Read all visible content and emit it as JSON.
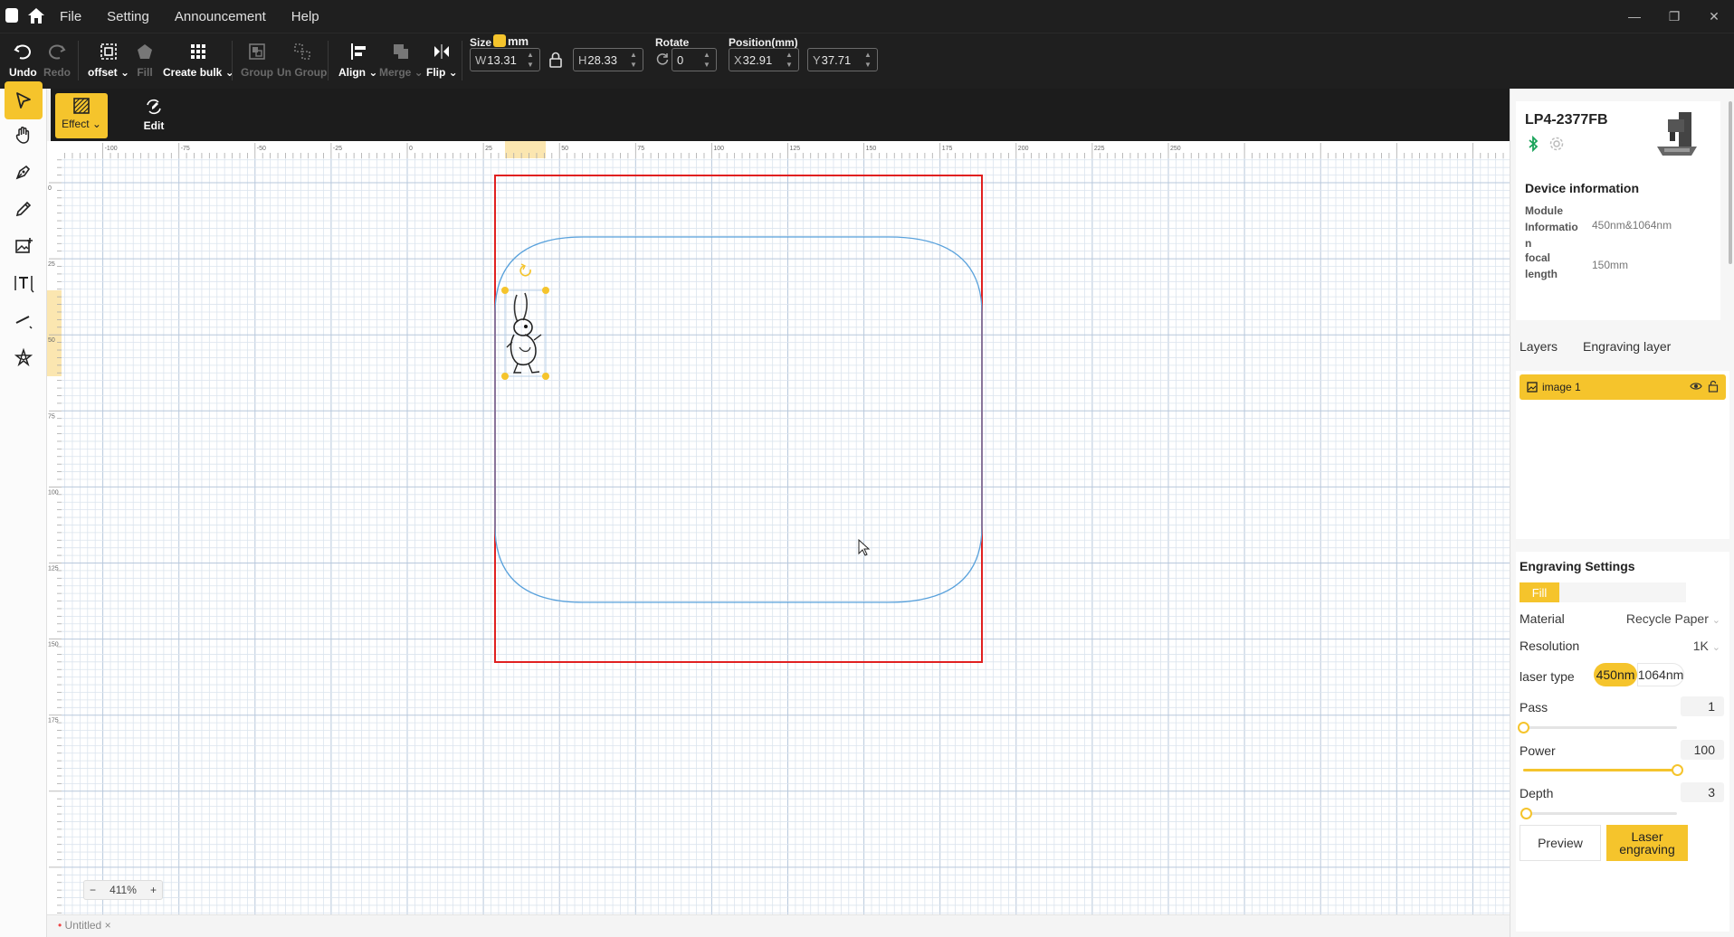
{
  "titlebar": {
    "menu": [
      "File",
      "Setting",
      "Announcement",
      "Help"
    ]
  },
  "toolbar": {
    "undo": "Undo",
    "redo": "Redo",
    "offset": "offset",
    "fill": "Fill",
    "create_bulk": "Create bulk",
    "group": "Group",
    "ungroup": "Un Group",
    "align": "Align",
    "merge": "Merge",
    "flip": "Flip",
    "size_label": "Size",
    "unit": "mm",
    "width_prefix": "W",
    "width": "13.31",
    "height_prefix": "H",
    "height": "28.33",
    "rotate_label": "Rotate",
    "rotate": "0",
    "position_label": "Position(mm)",
    "x_prefix": "X",
    "x": "32.91",
    "y_prefix": "Y",
    "y": "37.71"
  },
  "subbar": {
    "effect": "Effect",
    "edit": "Edit"
  },
  "ruler": {
    "h_labels": [
      "-100",
      "-75",
      "-50",
      "-25",
      "0",
      "25",
      "50",
      "75",
      "100",
      "125",
      "150",
      "175",
      "200",
      "225",
      "250"
    ],
    "v_labels": [
      "0",
      "25",
      "50",
      "75",
      "100",
      "125",
      "150",
      "175"
    ]
  },
  "zoom": {
    "minus": "−",
    "value": "411%",
    "plus": "+"
  },
  "document_tab": {
    "name": "Untitled",
    "close": "×"
  },
  "device": {
    "name": "LP4-2377FB",
    "info_title": "Device information",
    "module_label": "Module Informatio n",
    "module_value": "450nm&1064nm",
    "focal_label": "focal length",
    "focal_value": "150mm"
  },
  "layers": {
    "tab_layers": "Layers",
    "tab_engraving": "Engraving layer",
    "item": "image 1"
  },
  "engraving": {
    "title": "Engraving Settings",
    "mode": "Fill",
    "material_label": "Material",
    "material_value": "Recycle Paper",
    "resolution_label": "Resolution",
    "resolution_value": "1K",
    "laser_label": "laser type",
    "laser_a": "450nm",
    "laser_b": "1064nm",
    "pass_label": "Pass",
    "pass_value": "1",
    "pass_level": 0.0,
    "power_label": "Power",
    "power_value": "100",
    "power_level": 1.0,
    "depth_label": "Depth",
    "depth_value": "3",
    "depth_level": 0.02,
    "preview": "Preview",
    "laser_engraving": "Laser engraving"
  },
  "colors": {
    "accent": "#f5c42c",
    "work_area_border": "#e02020",
    "shape_outline": "#5aa2dc"
  }
}
